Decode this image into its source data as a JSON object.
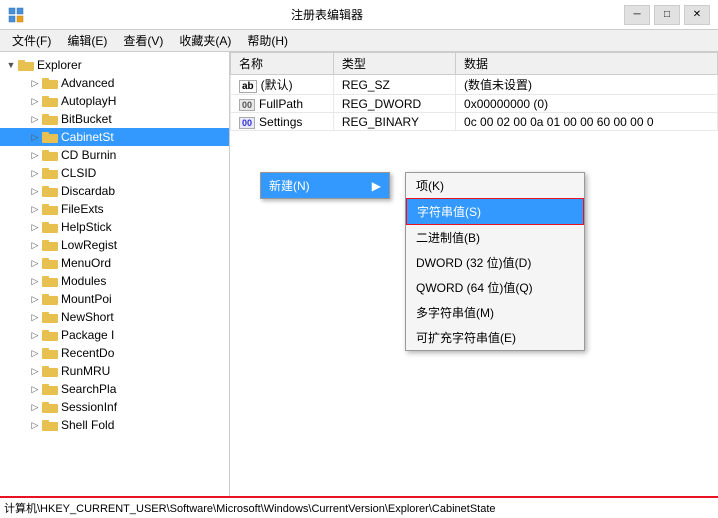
{
  "titleBar": {
    "title": "注册表编辑器",
    "icon": "regedit-icon",
    "minBtn": "─",
    "maxBtn": "□",
    "closeBtn": "✕"
  },
  "menuBar": {
    "items": [
      {
        "label": "文件(F)"
      },
      {
        "label": "编辑(E)"
      },
      {
        "label": "查看(V)"
      },
      {
        "label": "收藏夹(A)"
      },
      {
        "label": "帮助(H)"
      }
    ]
  },
  "tree": {
    "rootLabel": "Explorer",
    "children": [
      {
        "label": "Advanced",
        "selected": false
      },
      {
        "label": "AutoplayH",
        "selected": false
      },
      {
        "label": "BitBucket",
        "selected": false
      },
      {
        "label": "CabinetSt",
        "selected": true
      },
      {
        "label": "CD Burnin",
        "selected": false
      },
      {
        "label": "CLSID",
        "selected": false
      },
      {
        "label": "Discardab",
        "selected": false
      },
      {
        "label": "FileExts",
        "selected": false
      },
      {
        "label": "HelpStick",
        "selected": false
      },
      {
        "label": "LowRegist",
        "selected": false
      },
      {
        "label": "MenuOrd",
        "selected": false
      },
      {
        "label": "Modules",
        "selected": false
      },
      {
        "label": "MountPoi",
        "selected": false
      },
      {
        "label": "NewShort",
        "selected": false
      },
      {
        "label": "Package I",
        "selected": false
      },
      {
        "label": "RecentDo",
        "selected": false
      },
      {
        "label": "RunMRU",
        "selected": false
      },
      {
        "label": "SearchPla",
        "selected": false
      },
      {
        "label": "SessionInf",
        "selected": false
      },
      {
        "label": "Shell Fold",
        "selected": false
      }
    ]
  },
  "tableHeaders": [
    "名称",
    "类型",
    "数据"
  ],
  "tableRows": [
    {
      "name": "(默认)",
      "type": "REG_SZ",
      "data": "(数值未设置)",
      "iconType": "ab"
    },
    {
      "name": "FullPath",
      "type": "REG_DWORD",
      "data": "0x00000000 (0)",
      "iconType": "dword"
    },
    {
      "name": "Settings",
      "type": "REG_BINARY",
      "data": "0c 00 02 00 0a 01 00 00 60 00 00 0",
      "iconType": "binary"
    }
  ],
  "contextMenu": {
    "newLabel": "新建(N)",
    "arrow": "▶",
    "submenuItems": [
      {
        "label": "项(K)",
        "highlighted": false
      },
      {
        "label": "字符串值(S)",
        "highlighted": true
      },
      {
        "label": "二进制值(B)",
        "highlighted": false
      },
      {
        "label": "DWORD (32 位)值(D)",
        "highlighted": false
      },
      {
        "label": "QWORD (64 位)值(Q)",
        "highlighted": false
      },
      {
        "label": "多字符串值(M)",
        "highlighted": false
      },
      {
        "label": "可扩充字符串值(E)",
        "highlighted": false
      }
    ]
  },
  "statusBar": {
    "text": "计算机\\HKEY_CURRENT_USER\\Software\\Microsoft\\Windows\\CurrentVersion\\Explorer\\CabinetState"
  }
}
